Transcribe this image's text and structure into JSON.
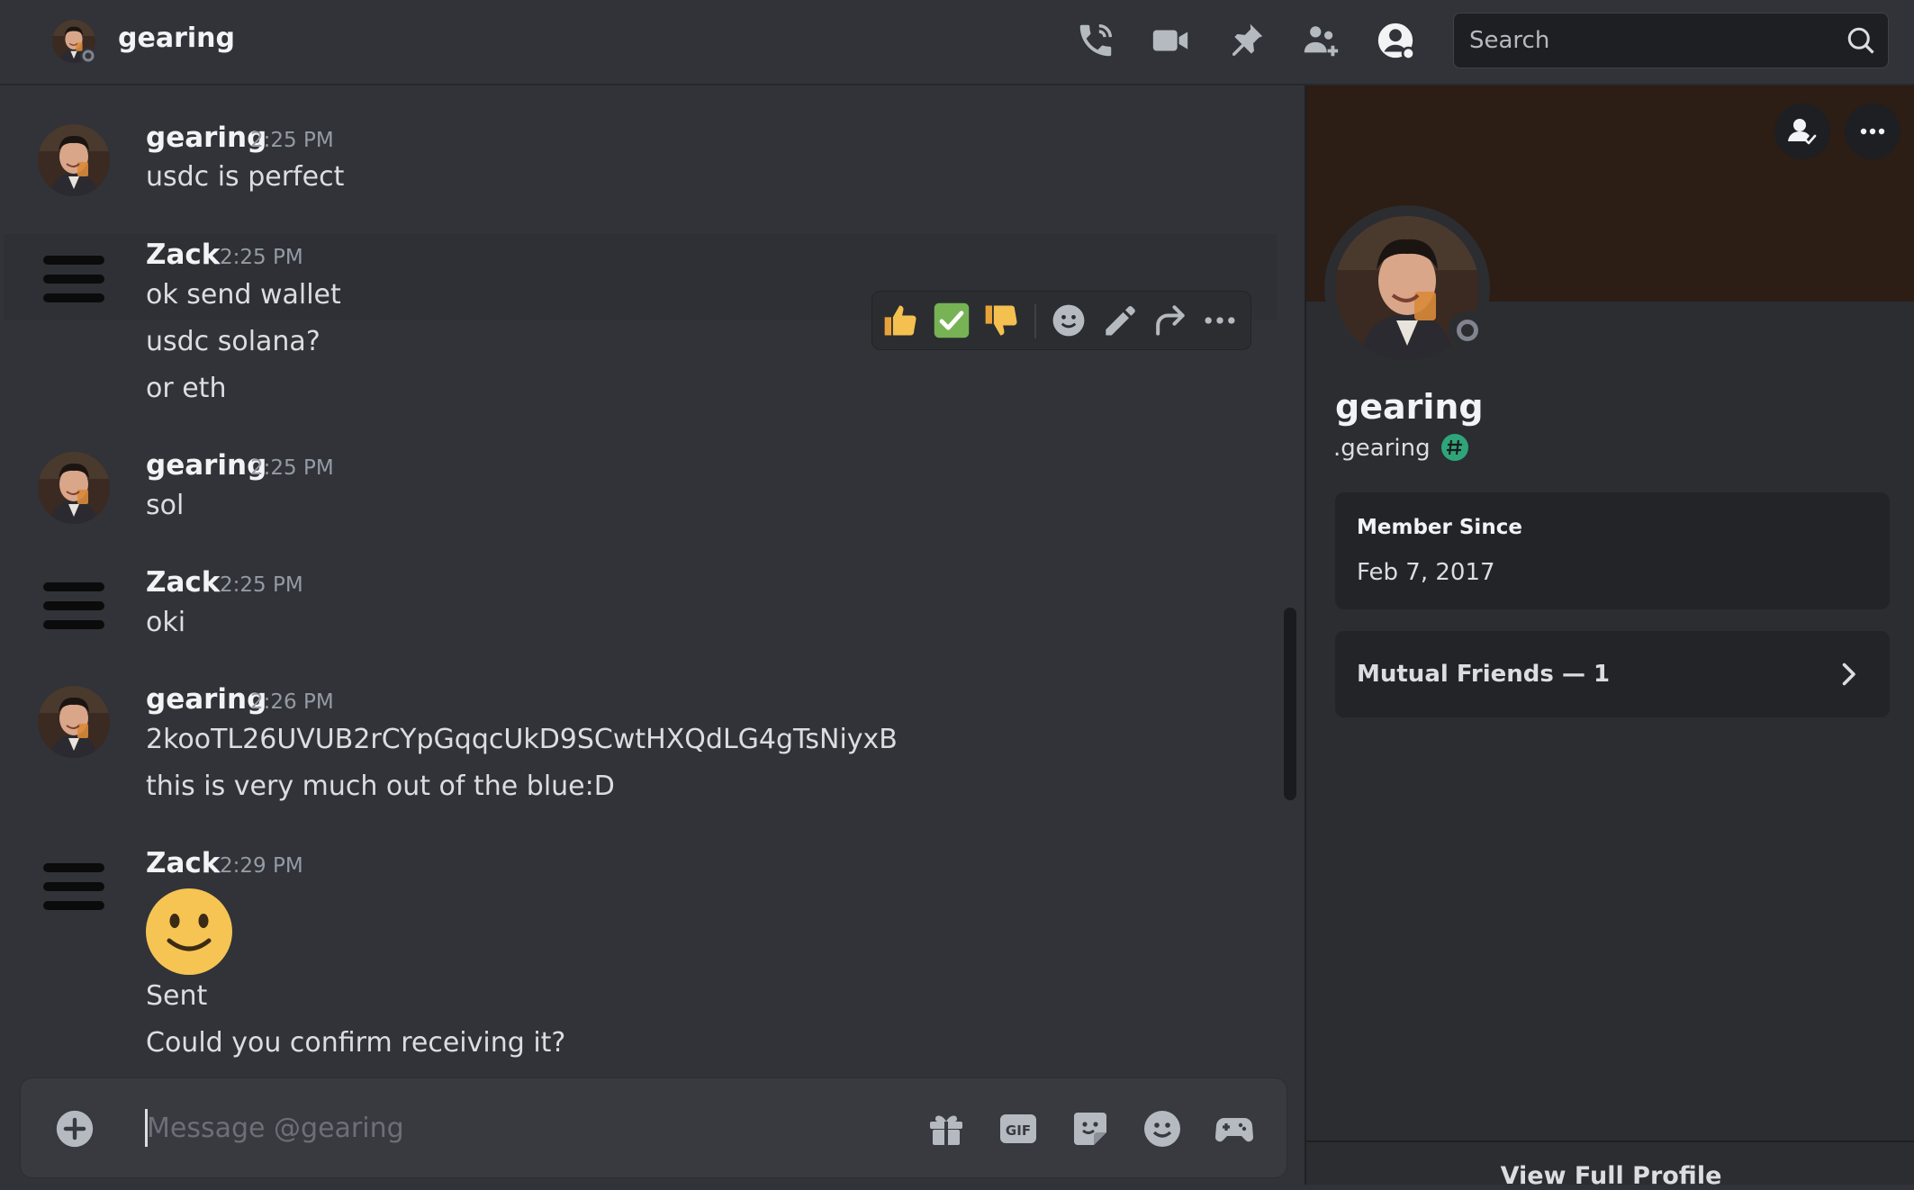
{
  "header": {
    "dm_name": "gearing",
    "search_placeholder": "Search",
    "icons": [
      "voice-call-icon",
      "video-call-icon",
      "pinned-messages-icon",
      "add-friends-to-dm-icon",
      "user-profile-icon",
      "search-icon"
    ]
  },
  "messages": [
    {
      "author": "gearing",
      "time": "2:25 PM",
      "lines": [
        "usdc is perfect"
      ]
    },
    {
      "author": "Zack",
      "time": "2:25 PM",
      "lines": [
        "ok send wallet",
        "usdc solana?",
        "or eth"
      ]
    },
    {
      "author": "gearing",
      "time": "2:25 PM",
      "lines": [
        "sol"
      ]
    },
    {
      "author": "Zack",
      "time": "2:25 PM",
      "lines": [
        "oki"
      ]
    },
    {
      "author": "gearing",
      "time": "2:26 PM",
      "lines": [
        "2kooTL26UVUB2rCYpGqqcUkD9SCwtHXQdLG4gTsNiyxB",
        "this is very much out of the blue:D"
      ]
    },
    {
      "author": "Zack",
      "time": "2:29 PM",
      "emoji": "slightly-smiling-face",
      "lines": [
        "Sent",
        "Could you confirm receiving it?"
      ]
    }
  ],
  "message_actions": [
    "thumbs-up-reaction",
    "check-mark-reaction",
    "thumbs-down-reaction",
    "add-reaction",
    "edit",
    "forward",
    "more"
  ],
  "composer": {
    "placeholder": "Message @gearing",
    "icons": [
      "gift-icon",
      "gif-icon",
      "sticker-icon",
      "emoji-icon",
      "apps-icon"
    ]
  },
  "profile": {
    "display_name": "gearing",
    "username": ".gearing",
    "member_since_label": "Member Since",
    "member_since_value": "Feb 7, 2017",
    "mutual_friends_label": "Mutual Friends — 1",
    "view_full_profile": "View Full Profile"
  },
  "colors": {
    "background": "#313338",
    "panel": "#2b2d31",
    "banner": "#2c1d15",
    "text": "#dbdee1",
    "muted": "#949ba4"
  }
}
